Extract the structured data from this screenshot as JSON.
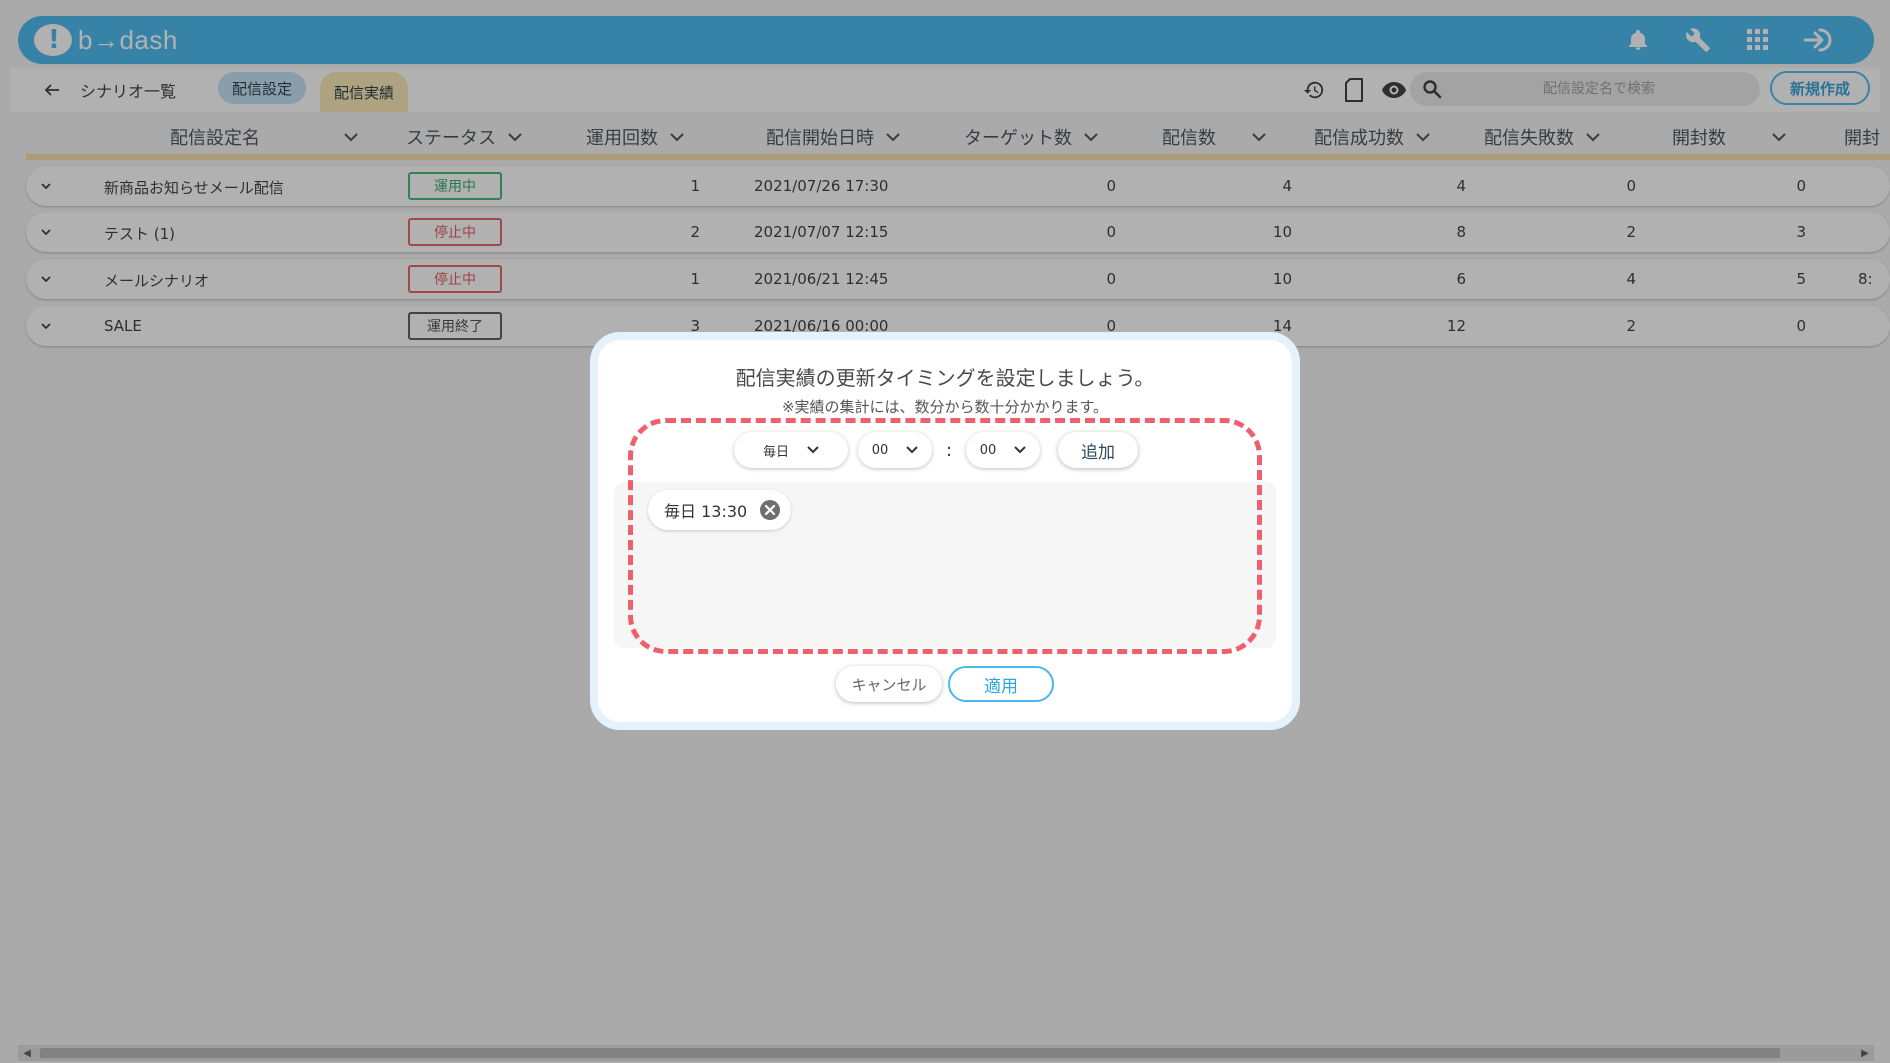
{
  "header": {
    "logo_text": "b→dash",
    "icons": [
      "bell-icon",
      "wrench-icon",
      "grid-icon",
      "logout-icon"
    ]
  },
  "subbar": {
    "breadcrumb": "シナリオ一覧",
    "tabs": [
      {
        "label": "配信設定",
        "active": false
      },
      {
        "label": "配信実績",
        "active": true
      }
    ],
    "search_placeholder": "配信設定名で検索",
    "new_button": "新規作成"
  },
  "table": {
    "columns": [
      "配信設定名",
      "ステータス",
      "運用回数",
      "配信開始日時",
      "ターゲット数",
      "配信数",
      "配信成功数",
      "配信失敗数",
      "開封数",
      "開封"
    ],
    "rows": [
      {
        "name": "新商品お知らせメール配信",
        "status": "運用中",
        "status_type": "active",
        "runs": "1",
        "start": "2021/07/26 17:30",
        "target": "0",
        "sent": "4",
        "success": "4",
        "fail": "0",
        "open": "0",
        "extra": ""
      },
      {
        "name": "テスト (1)",
        "status": "停止中",
        "status_type": "stopped",
        "runs": "2",
        "start": "2021/07/07 12:15",
        "target": "0",
        "sent": "10",
        "success": "8",
        "fail": "2",
        "open": "3",
        "extra": ""
      },
      {
        "name": "メールシナリオ",
        "status": "停止中",
        "status_type": "stopped",
        "runs": "1",
        "start": "2021/06/21 12:45",
        "target": "0",
        "sent": "10",
        "success": "6",
        "fail": "4",
        "open": "5",
        "extra": "8:"
      },
      {
        "name": "SALE",
        "status": "運用終了",
        "status_type": "ended",
        "runs": "3",
        "start": "2021/06/16 00:00",
        "target": "0",
        "sent": "14",
        "success": "12",
        "fail": "2",
        "open": "0",
        "extra": ""
      }
    ]
  },
  "modal": {
    "title": "配信実績の更新タイミングを設定しましょう。",
    "note": "※実績の集計には、数分から数十分かかります。",
    "frequency": "毎日",
    "hour": "00",
    "minute": "00",
    "separator": ":",
    "add_button": "追加",
    "schedules": [
      "毎日 13:30"
    ],
    "cancel_button": "キャンセル",
    "apply_button": "適用"
  },
  "colors": {
    "header_blue": "#40b8f0",
    "accent_blue": "#4ab8ea",
    "status_active": "#36b870",
    "status_stopped": "#e65a5a",
    "dashed_highlight": "#ef5f6d",
    "results_tab": "#fbe9b3"
  }
}
